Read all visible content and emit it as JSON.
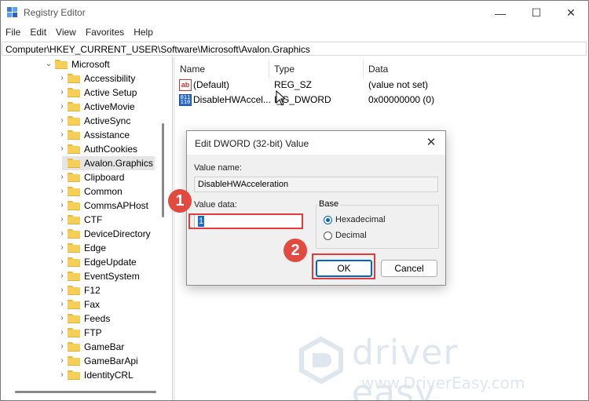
{
  "window": {
    "title": "Registry Editor",
    "controls": {
      "minimize": "—",
      "maximize": "☐",
      "close": "✕"
    }
  },
  "menu": [
    "File",
    "Edit",
    "View",
    "Favorites",
    "Help"
  ],
  "address": "Computer\\HKEY_CURRENT_USER\\Software\\Microsoft\\Avalon.Graphics",
  "tree": {
    "parent": "Microsoft",
    "items": [
      "Accessibility",
      "Active Setup",
      "ActiveMovie",
      "ActiveSync",
      "Assistance",
      "AuthCookies",
      "Avalon.Graphics",
      "Clipboard",
      "Common",
      "CommsAPHost",
      "CTF",
      "DeviceDirectory",
      "Edge",
      "EdgeUpdate",
      "EventSystem",
      "F12",
      "Fax",
      "Feeds",
      "FTP",
      "GameBar",
      "GameBarApi",
      "IdentityCRL"
    ],
    "selected": "Avalon.Graphics"
  },
  "values_list": {
    "columns": [
      "Name",
      "Type",
      "Data"
    ],
    "rows": [
      {
        "name": "(Default)",
        "type": "REG_SZ",
        "data": "(value not set)",
        "icon": "string-value-icon"
      },
      {
        "name": "DisableHWAccel...",
        "type": "I_G_DWORD",
        "data": "0x00000000 (0)",
        "icon": "binary-value-icon"
      }
    ]
  },
  "dialog": {
    "title": "Edit DWORD (32-bit) Value",
    "value_name_label": "Value name:",
    "value_name": "DisableHWAcceleration",
    "value_data_label": "Value data:",
    "value_data": "1",
    "base_label": "Base",
    "base_options": [
      "Hexadecimal",
      "Decimal"
    ],
    "base_selected": "Hexadecimal",
    "ok": "OK",
    "cancel": "Cancel",
    "close": "✕"
  },
  "annotations": {
    "step1": "1",
    "step2": "2",
    "highlight_color": "#e23b3b"
  },
  "watermark": {
    "brand": "driver easy",
    "url": "www.DriverEasy.com"
  }
}
